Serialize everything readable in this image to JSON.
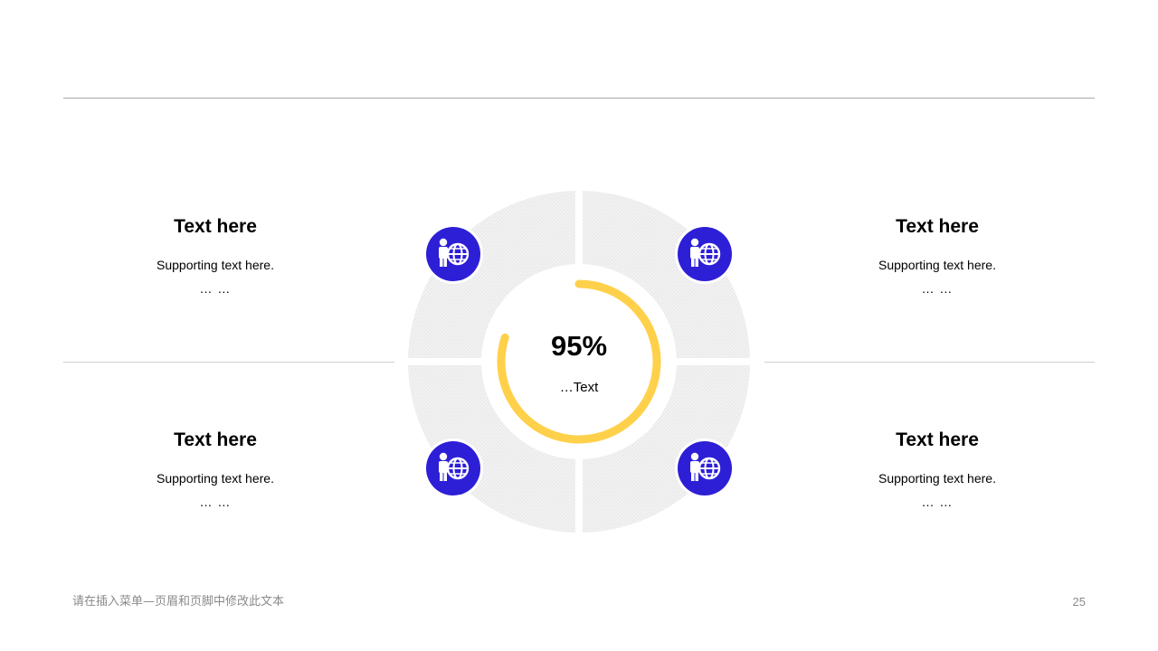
{
  "blocks": {
    "top_left": {
      "title": "Text here",
      "text": "Supporting  text here.",
      "ellipsis": "… …"
    },
    "top_right": {
      "title": "Text here",
      "text": "Supporting  text here.",
      "ellipsis": "… …"
    },
    "bottom_left": {
      "title": "Text here",
      "text": "Supporting  text here.",
      "ellipsis": "… …"
    },
    "bottom_right": {
      "title": "Text here",
      "text": "Supporting  text here.",
      "ellipsis": "… …"
    }
  },
  "center": {
    "value": "95%",
    "label": "…Text",
    "progress": 0.8
  },
  "icons": [
    "person-globe-icon",
    "person-globe-icon",
    "person-globe-icon",
    "person-globe-icon"
  ],
  "colors": {
    "accent": "#2d1fd6",
    "progress": "#ffd04a",
    "ring": "#efefef",
    "rule": "#a6a6a6"
  },
  "footer": {
    "text": "请在插入菜单—页眉和页脚中修改此文本",
    "page_number": "25"
  }
}
